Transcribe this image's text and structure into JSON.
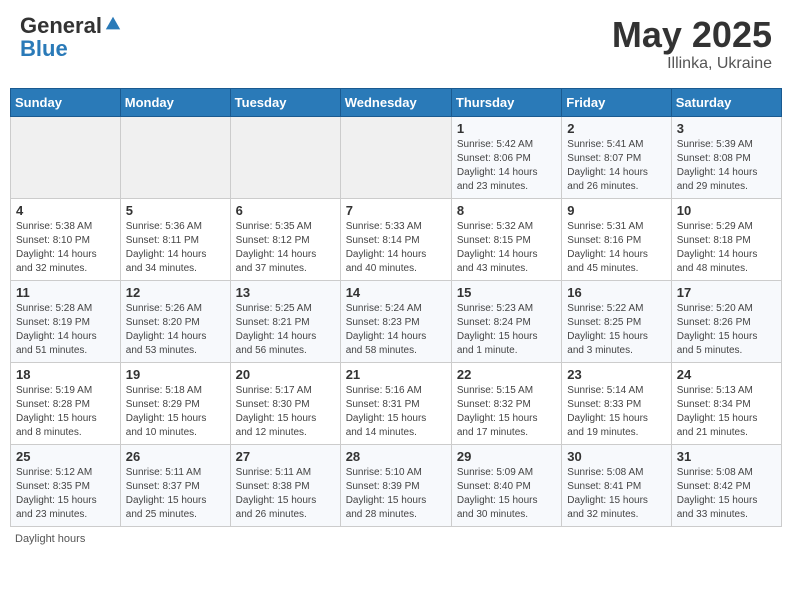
{
  "header": {
    "logo_general": "General",
    "logo_blue": "Blue",
    "title": "May 2025",
    "subtitle": "Illinka, Ukraine"
  },
  "calendar": {
    "days_of_week": [
      "Sunday",
      "Monday",
      "Tuesday",
      "Wednesday",
      "Thursday",
      "Friday",
      "Saturday"
    ],
    "weeks": [
      [
        {
          "num": "",
          "info": ""
        },
        {
          "num": "",
          "info": ""
        },
        {
          "num": "",
          "info": ""
        },
        {
          "num": "",
          "info": ""
        },
        {
          "num": "1",
          "info": "Sunrise: 5:42 AM\nSunset: 8:06 PM\nDaylight: 14 hours\nand 23 minutes."
        },
        {
          "num": "2",
          "info": "Sunrise: 5:41 AM\nSunset: 8:07 PM\nDaylight: 14 hours\nand 26 minutes."
        },
        {
          "num": "3",
          "info": "Sunrise: 5:39 AM\nSunset: 8:08 PM\nDaylight: 14 hours\nand 29 minutes."
        }
      ],
      [
        {
          "num": "4",
          "info": "Sunrise: 5:38 AM\nSunset: 8:10 PM\nDaylight: 14 hours\nand 32 minutes."
        },
        {
          "num": "5",
          "info": "Sunrise: 5:36 AM\nSunset: 8:11 PM\nDaylight: 14 hours\nand 34 minutes."
        },
        {
          "num": "6",
          "info": "Sunrise: 5:35 AM\nSunset: 8:12 PM\nDaylight: 14 hours\nand 37 minutes."
        },
        {
          "num": "7",
          "info": "Sunrise: 5:33 AM\nSunset: 8:14 PM\nDaylight: 14 hours\nand 40 minutes."
        },
        {
          "num": "8",
          "info": "Sunrise: 5:32 AM\nSunset: 8:15 PM\nDaylight: 14 hours\nand 43 minutes."
        },
        {
          "num": "9",
          "info": "Sunrise: 5:31 AM\nSunset: 8:16 PM\nDaylight: 14 hours\nand 45 minutes."
        },
        {
          "num": "10",
          "info": "Sunrise: 5:29 AM\nSunset: 8:18 PM\nDaylight: 14 hours\nand 48 minutes."
        }
      ],
      [
        {
          "num": "11",
          "info": "Sunrise: 5:28 AM\nSunset: 8:19 PM\nDaylight: 14 hours\nand 51 minutes."
        },
        {
          "num": "12",
          "info": "Sunrise: 5:26 AM\nSunset: 8:20 PM\nDaylight: 14 hours\nand 53 minutes."
        },
        {
          "num": "13",
          "info": "Sunrise: 5:25 AM\nSunset: 8:21 PM\nDaylight: 14 hours\nand 56 minutes."
        },
        {
          "num": "14",
          "info": "Sunrise: 5:24 AM\nSunset: 8:23 PM\nDaylight: 14 hours\nand 58 minutes."
        },
        {
          "num": "15",
          "info": "Sunrise: 5:23 AM\nSunset: 8:24 PM\nDaylight: 15 hours\nand 1 minute."
        },
        {
          "num": "16",
          "info": "Sunrise: 5:22 AM\nSunset: 8:25 PM\nDaylight: 15 hours\nand 3 minutes."
        },
        {
          "num": "17",
          "info": "Sunrise: 5:20 AM\nSunset: 8:26 PM\nDaylight: 15 hours\nand 5 minutes."
        }
      ],
      [
        {
          "num": "18",
          "info": "Sunrise: 5:19 AM\nSunset: 8:28 PM\nDaylight: 15 hours\nand 8 minutes."
        },
        {
          "num": "19",
          "info": "Sunrise: 5:18 AM\nSunset: 8:29 PM\nDaylight: 15 hours\nand 10 minutes."
        },
        {
          "num": "20",
          "info": "Sunrise: 5:17 AM\nSunset: 8:30 PM\nDaylight: 15 hours\nand 12 minutes."
        },
        {
          "num": "21",
          "info": "Sunrise: 5:16 AM\nSunset: 8:31 PM\nDaylight: 15 hours\nand 14 minutes."
        },
        {
          "num": "22",
          "info": "Sunrise: 5:15 AM\nSunset: 8:32 PM\nDaylight: 15 hours\nand 17 minutes."
        },
        {
          "num": "23",
          "info": "Sunrise: 5:14 AM\nSunset: 8:33 PM\nDaylight: 15 hours\nand 19 minutes."
        },
        {
          "num": "24",
          "info": "Sunrise: 5:13 AM\nSunset: 8:34 PM\nDaylight: 15 hours\nand 21 minutes."
        }
      ],
      [
        {
          "num": "25",
          "info": "Sunrise: 5:12 AM\nSunset: 8:35 PM\nDaylight: 15 hours\nand 23 minutes."
        },
        {
          "num": "26",
          "info": "Sunrise: 5:11 AM\nSunset: 8:37 PM\nDaylight: 15 hours\nand 25 minutes."
        },
        {
          "num": "27",
          "info": "Sunrise: 5:11 AM\nSunset: 8:38 PM\nDaylight: 15 hours\nand 26 minutes."
        },
        {
          "num": "28",
          "info": "Sunrise: 5:10 AM\nSunset: 8:39 PM\nDaylight: 15 hours\nand 28 minutes."
        },
        {
          "num": "29",
          "info": "Sunrise: 5:09 AM\nSunset: 8:40 PM\nDaylight: 15 hours\nand 30 minutes."
        },
        {
          "num": "30",
          "info": "Sunrise: 5:08 AM\nSunset: 8:41 PM\nDaylight: 15 hours\nand 32 minutes."
        },
        {
          "num": "31",
          "info": "Sunrise: 5:08 AM\nSunset: 8:42 PM\nDaylight: 15 hours\nand 33 minutes."
        }
      ]
    ]
  },
  "footer": {
    "text": "Daylight hours"
  }
}
